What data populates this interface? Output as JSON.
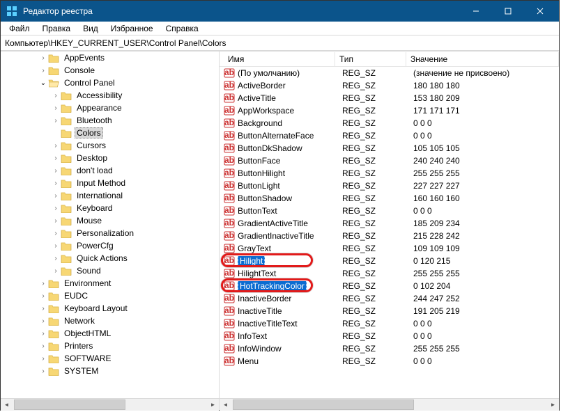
{
  "window": {
    "title": "Редактор реестра"
  },
  "menu": [
    "Файл",
    "Правка",
    "Вид",
    "Избранное",
    "Справка"
  ],
  "address": "Компьютер\\HKEY_CURRENT_USER\\Control Panel\\Colors",
  "tree": [
    {
      "depth": 3,
      "arrow": ">",
      "label": "AppEvents"
    },
    {
      "depth": 3,
      "arrow": ">",
      "label": "Console"
    },
    {
      "depth": 3,
      "arrow": "v",
      "label": "Control Panel"
    },
    {
      "depth": 4,
      "arrow": ">",
      "label": "Accessibility"
    },
    {
      "depth": 4,
      "arrow": ">",
      "label": "Appearance"
    },
    {
      "depth": 4,
      "arrow": ">",
      "label": "Bluetooth"
    },
    {
      "depth": 4,
      "arrow": "",
      "label": "Colors",
      "selected": true
    },
    {
      "depth": 4,
      "arrow": ">",
      "label": "Cursors"
    },
    {
      "depth": 4,
      "arrow": ">",
      "label": "Desktop"
    },
    {
      "depth": 4,
      "arrow": ">",
      "label": "don't load"
    },
    {
      "depth": 4,
      "arrow": ">",
      "label": "Input Method"
    },
    {
      "depth": 4,
      "arrow": ">",
      "label": "International"
    },
    {
      "depth": 4,
      "arrow": ">",
      "label": "Keyboard"
    },
    {
      "depth": 4,
      "arrow": ">",
      "label": "Mouse"
    },
    {
      "depth": 4,
      "arrow": ">",
      "label": "Personalization"
    },
    {
      "depth": 4,
      "arrow": ">",
      "label": "PowerCfg"
    },
    {
      "depth": 4,
      "arrow": ">",
      "label": "Quick Actions"
    },
    {
      "depth": 4,
      "arrow": ">",
      "label": "Sound"
    },
    {
      "depth": 3,
      "arrow": ">",
      "label": "Environment"
    },
    {
      "depth": 3,
      "arrow": ">",
      "label": "EUDC"
    },
    {
      "depth": 3,
      "arrow": ">",
      "label": "Keyboard Layout"
    },
    {
      "depth": 3,
      "arrow": ">",
      "label": "Network"
    },
    {
      "depth": 3,
      "arrow": ">",
      "label": "ObjectHTML"
    },
    {
      "depth": 3,
      "arrow": ">",
      "label": "Printers"
    },
    {
      "depth": 3,
      "arrow": ">",
      "label": "SOFTWARE"
    },
    {
      "depth": 3,
      "arrow": ">",
      "label": "SYSTEM"
    }
  ],
  "columns": {
    "name": "Имя",
    "type": "Тип",
    "value": "Значение"
  },
  "values": [
    {
      "name": "(По умолчанию)",
      "type": "REG_SZ",
      "value": "(значение не присвоено)"
    },
    {
      "name": "ActiveBorder",
      "type": "REG_SZ",
      "value": "180 180 180"
    },
    {
      "name": "ActiveTitle",
      "type": "REG_SZ",
      "value": "153 180 209"
    },
    {
      "name": "AppWorkspace",
      "type": "REG_SZ",
      "value": "171 171 171"
    },
    {
      "name": "Background",
      "type": "REG_SZ",
      "value": "0 0 0"
    },
    {
      "name": "ButtonAlternateFace",
      "type": "REG_SZ",
      "value": "0 0 0"
    },
    {
      "name": "ButtonDkShadow",
      "type": "REG_SZ",
      "value": "105 105 105"
    },
    {
      "name": "ButtonFace",
      "type": "REG_SZ",
      "value": "240 240 240"
    },
    {
      "name": "ButtonHilight",
      "type": "REG_SZ",
      "value": "255 255 255"
    },
    {
      "name": "ButtonLight",
      "type": "REG_SZ",
      "value": "227 227 227"
    },
    {
      "name": "ButtonShadow",
      "type": "REG_SZ",
      "value": "160 160 160"
    },
    {
      "name": "ButtonText",
      "type": "REG_SZ",
      "value": "0 0 0"
    },
    {
      "name": "GradientActiveTitle",
      "type": "REG_SZ",
      "value": "185 209 234"
    },
    {
      "name": "GradientInactiveTitle",
      "type": "REG_SZ",
      "value": "215 228 242"
    },
    {
      "name": "GrayText",
      "type": "REG_SZ",
      "value": "109 109 109"
    },
    {
      "name": "Hilight",
      "type": "REG_SZ",
      "value": "0 120 215",
      "selected": true,
      "circled": true
    },
    {
      "name": "HilightText",
      "type": "REG_SZ",
      "value": "255 255 255"
    },
    {
      "name": "HotTrackingColor",
      "type": "REG_SZ",
      "value": "0 102 204",
      "selected": true,
      "circled": true
    },
    {
      "name": "InactiveBorder",
      "type": "REG_SZ",
      "value": "244 247 252"
    },
    {
      "name": "InactiveTitle",
      "type": "REG_SZ",
      "value": "191 205 219"
    },
    {
      "name": "InactiveTitleText",
      "type": "REG_SZ",
      "value": "0 0 0"
    },
    {
      "name": "InfoText",
      "type": "REG_SZ",
      "value": "0 0 0"
    },
    {
      "name": "InfoWindow",
      "type": "REG_SZ",
      "value": "255 255 255"
    },
    {
      "name": "Menu",
      "type": "REG_SZ",
      "value": "0 0 0"
    }
  ]
}
